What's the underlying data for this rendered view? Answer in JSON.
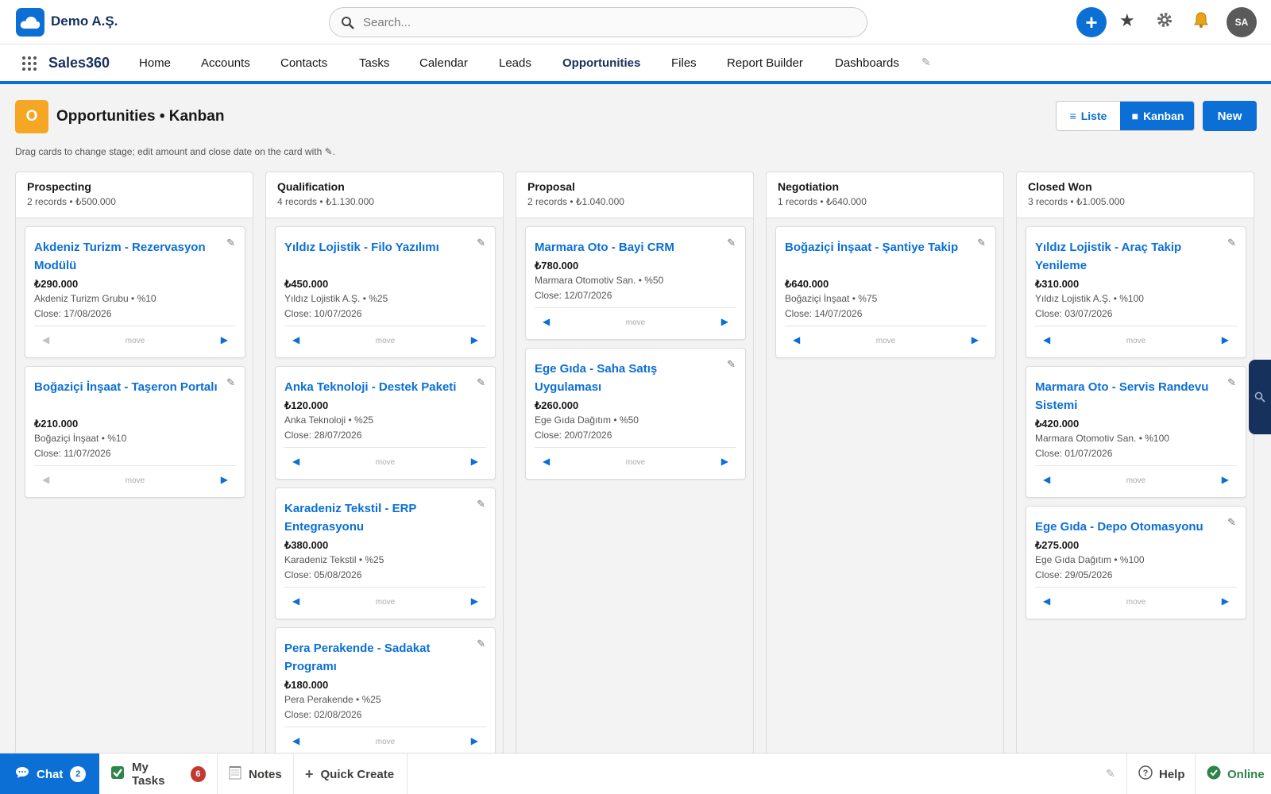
{
  "org": {
    "name": "Demo A.Ş."
  },
  "search": {
    "placeholder": "Search..."
  },
  "header_actions": {
    "add": "+",
    "avatar_initials": "SA"
  },
  "nav": {
    "app_name": "Sales360",
    "items": [
      "Home",
      "Accounts",
      "Contacts",
      "Tasks",
      "Calendar",
      "Leads",
      "Opportunities",
      "Files",
      "Report Builder",
      "Dashboards"
    ],
    "active": "Opportunities"
  },
  "page": {
    "icon_letter": "O",
    "title": "Opportunities • Kanban",
    "hint": "Drag cards to change stage; edit amount and close date on the card with ✎.",
    "view_list": "Liste",
    "view_kanban": "Kanban",
    "new_button": "New"
  },
  "move_label": "move",
  "columns": [
    {
      "title": "Prospecting",
      "meta": "2 records • ₺500.000",
      "cards": [
        {
          "title": "Akdeniz Turizm - Rezervasyon Modülü",
          "amount": "₺290.000",
          "account": "Akdeniz Turizm Grubu • %10",
          "close": "Close: 17/08/2026"
        },
        {
          "title": "Boğaziçi İnşaat - Taşeron Portalı",
          "amount": "₺210.000",
          "account": "Boğaziçi İnşaat • %10",
          "close": "Close: 11/07/2026"
        }
      ]
    },
    {
      "title": "Qualification",
      "meta": "4 records • ₺1.130.000",
      "cards": [
        {
          "title": "Yıldız Lojistik - Filo Yazılımı",
          "amount": "₺450.000",
          "account": "Yıldız Lojistik A.Ş. • %25",
          "close": "Close: 10/07/2026"
        },
        {
          "title": "Anka Teknoloji - Destek Paketi",
          "amount": "₺120.000",
          "account": "Anka Teknoloji • %25",
          "close": "Close: 28/07/2026"
        },
        {
          "title": "Karadeniz Tekstil - ERP Entegrasyonu",
          "amount": "₺380.000",
          "account": "Karadeniz Tekstil • %25",
          "close": "Close: 05/08/2026"
        },
        {
          "title": "Pera Perakende - Sadakat Programı",
          "amount": "₺180.000",
          "account": "Pera Perakende • %25",
          "close": "Close: 02/08/2026"
        }
      ]
    },
    {
      "title": "Proposal",
      "meta": "2 records • ₺1.040.000",
      "cards": [
        {
          "title": "Marmara Oto - Bayi CRM",
          "amount": "₺780.000",
          "account": "Marmara Otomotiv San. • %50",
          "close": "Close: 12/07/2026"
        },
        {
          "title": "Ege Gıda - Saha Satış Uygulaması",
          "amount": "₺260.000",
          "account": "Ege Gıda Dağıtım • %50",
          "close": "Close: 20/07/2026"
        }
      ]
    },
    {
      "title": "Negotiation",
      "meta": "1 records • ₺640.000",
      "cards": [
        {
          "title": "Boğaziçi İnşaat - Şantiye Takip",
          "amount": "₺640.000",
          "account": "Boğaziçi İnşaat • %75",
          "close": "Close: 14/07/2026"
        }
      ]
    },
    {
      "title": "Closed Won",
      "meta": "3 records • ₺1.005.000",
      "cards": [
        {
          "title": "Yıldız Lojistik - Araç Takip Yenileme",
          "amount": "₺310.000",
          "account": "Yıldız Lojistik A.Ş. • %100",
          "close": "Close: 03/07/2026"
        },
        {
          "title": "Marmara Oto - Servis Randevu Sistemi",
          "amount": "₺420.000",
          "account": "Marmara Otomotiv San. • %100",
          "close": "Close: 01/07/2026"
        },
        {
          "title": "Ege Gıda - Depo Otomasyonu",
          "amount": "₺275.000",
          "account": "Ege Gıda Dağıtım • %100",
          "close": "Close: 29/05/2026"
        }
      ]
    }
  ],
  "utility": {
    "chat": "Chat",
    "chat_count": "2",
    "tasks": "My Tasks",
    "tasks_count": "6",
    "notes": "Notes",
    "quick_create": "Quick Create",
    "help": "Help",
    "online": "Online"
  },
  "colors": {
    "brand": "#0b6fd6",
    "navy": "#16325c",
    "object_icon": "#f5a623",
    "online": "#2e844a",
    "badge": "#c23934"
  }
}
